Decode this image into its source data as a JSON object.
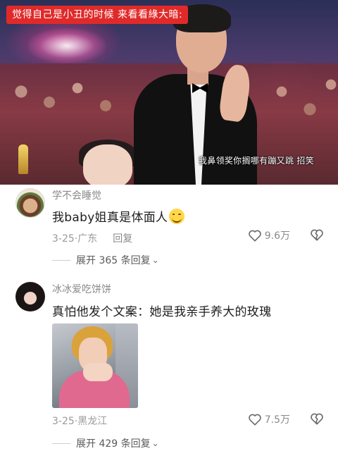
{
  "video": {
    "top_caption": "觉得自己是小丑的时候 来看看綠大暗:",
    "subtitle": "我鼻领奖你搁哪有蹦又跳 招笑"
  },
  "comments": [
    {
      "username": "学不会睡觉",
      "text": "我baby姐真是体面人",
      "emoji": "grinning-face-with-smiling-eyes",
      "date": "3-25",
      "location": "广东",
      "reply_label": "回复",
      "likes": "9.6万",
      "expand_label": "展开 365 条回复"
    },
    {
      "username": "冰冰爱吃饼饼",
      "text": "真怕他发个文案：她是我亲手养大的玫瑰",
      "date": "3-25",
      "location": "黑龙江",
      "likes": "7.5万",
      "expand_label": "展开 429 条回复"
    }
  ],
  "colors": {
    "caption_bg": "#e02a2a",
    "meta": "#9a9a9a",
    "username": "#8a8a8a"
  }
}
